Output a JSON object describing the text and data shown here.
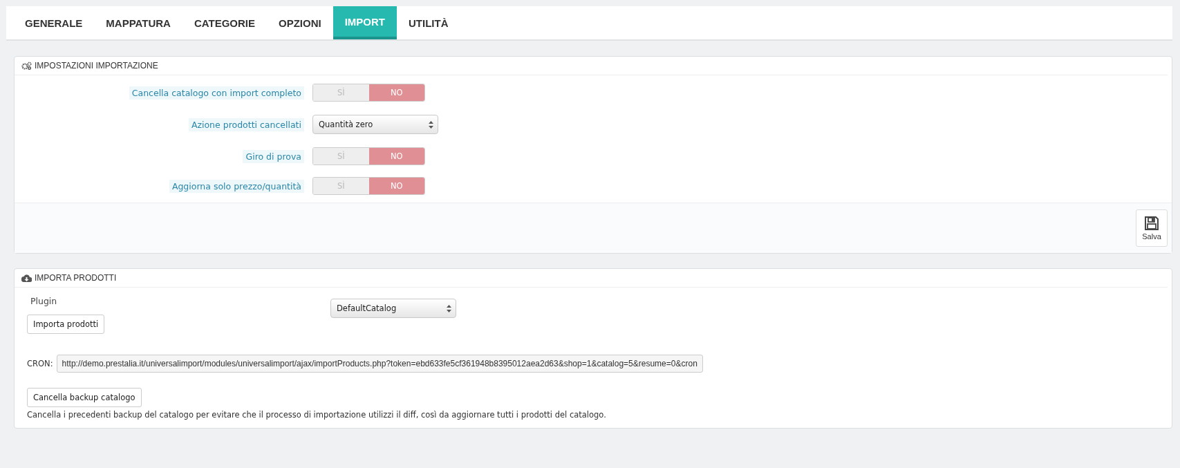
{
  "tabs": [
    {
      "label": "GENERALE",
      "selected": false
    },
    {
      "label": "MAPPATURA",
      "selected": false
    },
    {
      "label": "CATEGORIE",
      "selected": false
    },
    {
      "label": "OPZIONI",
      "selected": false
    },
    {
      "label": "IMPORT",
      "selected": true
    },
    {
      "label": "UTILITÀ",
      "selected": false
    }
  ],
  "settings_panel": {
    "title": "IMPOSTAZIONI IMPORTAZIONE",
    "rows": [
      {
        "kind": "toggle",
        "label": "Cancella catalogo con import completo",
        "yes_label": "SÌ",
        "no_label": "NO",
        "on": false
      },
      {
        "kind": "select",
        "label": "Azione prodotti cancellati",
        "value": "Quantità zero"
      },
      {
        "kind": "toggle",
        "label": "Giro di prova",
        "yes_label": "SÌ",
        "no_label": "NO",
        "on": false
      },
      {
        "kind": "toggle",
        "label": "Aggiorna solo prezzo/quantità",
        "yes_label": "SÌ",
        "no_label": "NO",
        "on": false
      }
    ],
    "save_button": "Salva"
  },
  "import_panel": {
    "title": "IMPORTA PRODOTTI",
    "plugin_label": "Plugin",
    "plugin_value": "DefaultCatalog",
    "import_button": "Importa prodotti",
    "cron_label": "CRON:",
    "cron_value": "http://demo.prestalia.it/universalimport/modules/universalimport/ajax/importProducts.php?token=ebd633fe5cf361948b8395012aea2d63&shop=1&catalog=5&resume=0&cron",
    "backup_button": "Cancella backup catalogo",
    "backup_help": "Cancella i precedenti backup del catalogo per evitare che il processo di importazione utilizzi il diff, così da aggiornare tutti i prodotti del catalogo."
  }
}
